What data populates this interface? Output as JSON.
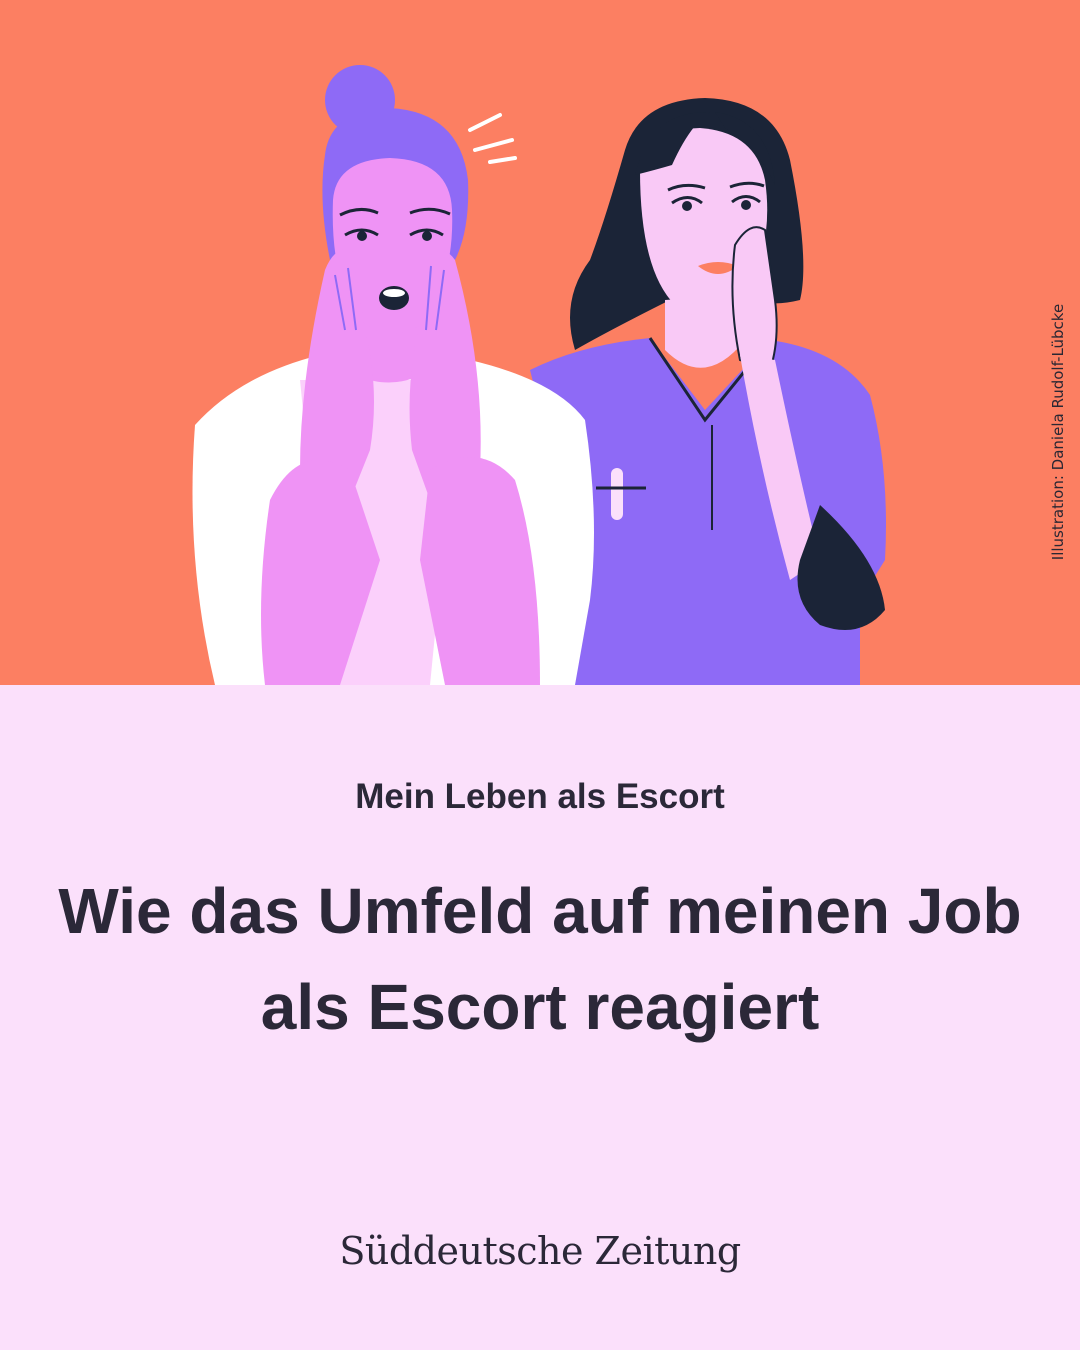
{
  "illustration": {
    "credit": "Illustration: Daniela Rudolf-Lübcke",
    "background_color": "#fc7f62"
  },
  "article": {
    "kicker": "Mein Leben als Escort",
    "headline": "Wie das Umfeld auf meinen Job als Escort reagiert"
  },
  "brand": {
    "name": "Süddeutsche Zeitung"
  },
  "colors": {
    "panel": "#fbe0fb",
    "text": "#2b2838",
    "skin_left": "#ef93f5",
    "hair_left": "#8e6af6",
    "shirt_purple": "#8e6af6",
    "hair_right": "#1b2437"
  }
}
